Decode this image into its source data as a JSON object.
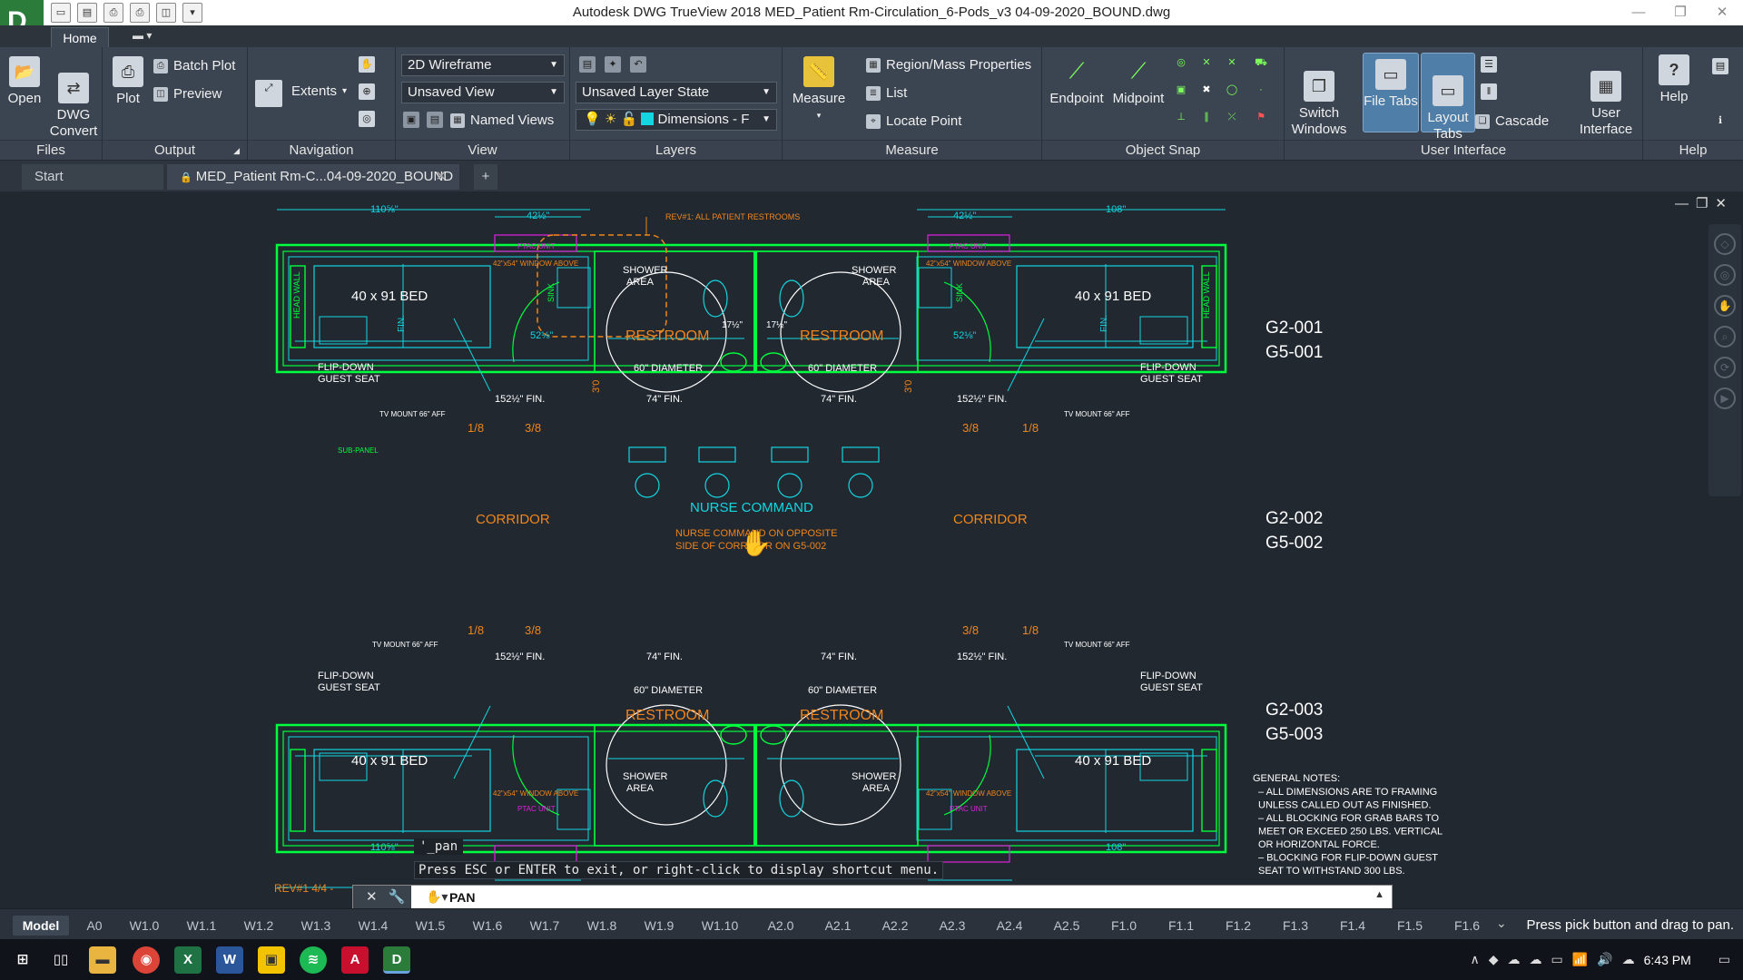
{
  "window": {
    "title": "Autodesk DWG TrueView 2018    MED_Patient Rm-Circulation_6-Pods_v3 04-09-2020_BOUND.dwg",
    "app_letter": "D"
  },
  "ribbon": {
    "tab": "Home",
    "panels": {
      "files": {
        "title": "Files",
        "open": "Open",
        "dwg_convert": "DWG\nConvert"
      },
      "output": {
        "title": "Output",
        "plot": "Plot",
        "batch_plot": "Batch Plot",
        "preview": "Preview"
      },
      "navigation": {
        "title": "Navigation",
        "extents": "Extents"
      },
      "view": {
        "title": "View",
        "visual_style": "2D Wireframe",
        "saved_view": "Unsaved View",
        "named_views": "Named Views"
      },
      "layers": {
        "title": "Layers",
        "layer_state": "Unsaved Layer State",
        "current_layer": "Dimensions - F"
      },
      "measure": {
        "title": "Measure",
        "measure": "Measure",
        "region": "Region/Mass Properties",
        "list": "List",
        "locate": "Locate Point"
      },
      "osnap": {
        "title": "Object Snap",
        "endpoint": "Endpoint",
        "midpoint": "Midpoint"
      },
      "ui": {
        "title": "User Interface",
        "switch_windows": "Switch\nWindows",
        "file_tabs": "File Tabs",
        "layout_tabs": "Layout\nTabs",
        "cascade": "Cascade",
        "user_interface": "User\nInterface"
      },
      "help": {
        "title": "Help",
        "help": "Help"
      }
    }
  },
  "file_tabs": {
    "start": "Start",
    "doc": "MED_Patient Rm-C...04-09-2020_BOUND"
  },
  "drawing": {
    "labels": {
      "g1": "G2-001",
      "g1b": "G5-001",
      "g2": "G2-002",
      "g2b": "G5-002",
      "g3": "G2-003",
      "g3b": "G5-003",
      "corridor": "CORRIDOR",
      "nurse_command": "NURSE COMMAND",
      "nurse_note1": "NURSE COMMAND ON OPPOSITE",
      "nurse_note2": "SIDE OF CORRIDOR ON G5-002",
      "rev_note": "REV#1: ALL PATIENT RESTROOMS",
      "bed": "40 x 91 BED",
      "restroom": "RESTROOM",
      "diameter": "60\" DIAMETER",
      "shower1": "SHOWER",
      "shower2": "AREA",
      "flip1": "FLIP-DOWN",
      "flip2": "GUEST SEAT",
      "ptac": "PTAC UNIT",
      "window": "42\"x54\" WINDOW ABOVE",
      "head_wall": "HEAD WALL",
      "sink": "SINK",
      "tv": "TV MOUNT 66\" AFF",
      "sub_panel": "SUB-PANEL",
      "fin74": "74\" FIN.",
      "fin152": "152½\" FIN.",
      "dim108": "108\"",
      "dim110": "110⅝\"",
      "dim42": "42½\"",
      "dim52": "52⅛\"",
      "dim17": "17½\"",
      "frac18": "1/8",
      "frac38": "3/8",
      "frac30": "3'0",
      "fin": "FIN.",
      "rev_bottom": "REV#1 4/4 -"
    },
    "notes": {
      "heading": "GENERAL NOTES:",
      "lines": [
        "–    ALL DIMENSIONS ARE TO FRAMING",
        "       UNLESS CALLED OUT AS FINISHED.",
        "–    ALL BLOCKING FOR GRAB BARS TO",
        "       MEET OR EXCEED 250 LBS. VERTICAL",
        "       OR HORIZONTAL FORCE.",
        "–    BLOCKING FOR FLIP-DOWN GUEST",
        "       SEAT TO WITHSTAND 300 LBS."
      ]
    }
  },
  "command": {
    "echo": "'_pan",
    "message": "Press ESC or ENTER to exit, or right-click to display shortcut menu.",
    "input": "PAN"
  },
  "layouts": [
    "Model",
    "A0",
    "W1.0",
    "W1.1",
    "W1.2",
    "W1.3",
    "W1.4",
    "W1.5",
    "W1.6",
    "W1.7",
    "W1.8",
    "W1.9",
    "W1.10",
    "A2.0",
    "A2.1",
    "A2.2",
    "A2.3",
    "A2.4",
    "A2.5",
    "F1.0",
    "F1.1",
    "F1.2",
    "F1.3",
    "F1.4",
    "F1.5",
    "F1.6"
  ],
  "status": {
    "text": "Press pick button and drag to pan."
  },
  "taskbar": {
    "time": "6:43 PM"
  },
  "colors": {
    "green": "#00ff3c",
    "cyan": "#13d6e0",
    "orange": "#f0851c",
    "magenta": "#e020e0",
    "bg": "#212830"
  }
}
